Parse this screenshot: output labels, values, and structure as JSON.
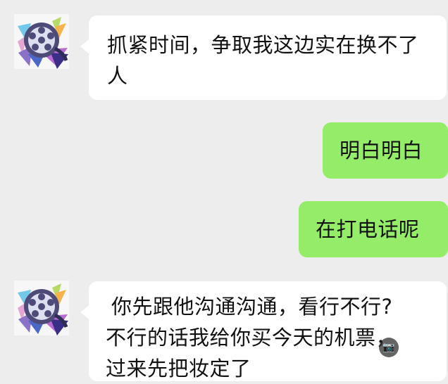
{
  "chat": {
    "messages": [
      {
        "sender": "contact",
        "text": "抓紧时间，争取我这边实在换不了人"
      },
      {
        "sender": "me",
        "text": "明白明白"
      },
      {
        "sender": "me",
        "text": "在打电话呢"
      },
      {
        "sender": "contact",
        "lines": [
          "你先跟他沟通沟通，看行不行?",
          "不行的话我给你买今天的机票，",
          "过来先把妆定了"
        ]
      }
    ]
  },
  "icons": {
    "contact_avatar": "film-reel-avatar-icon",
    "overlay": "camera-icon"
  },
  "colors": {
    "background": "#ededed",
    "incoming_bubble": "#ffffff",
    "outgoing_bubble": "#95ec69",
    "text": "#111111"
  }
}
